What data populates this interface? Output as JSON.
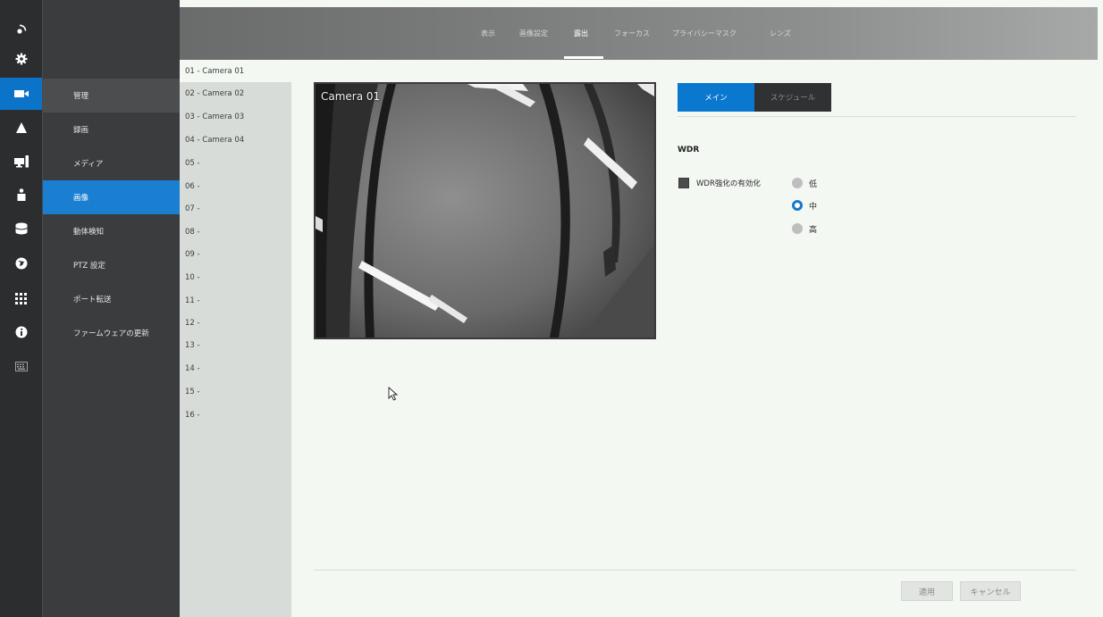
{
  "rail": {
    "icons": [
      {
        "name": "logo-icon"
      },
      {
        "name": "settings-icon"
      },
      {
        "name": "camera-icon",
        "active": true
      },
      {
        "name": "alert-icon"
      },
      {
        "name": "monitor-icon"
      },
      {
        "name": "user-icon"
      },
      {
        "name": "storage-icon"
      },
      {
        "name": "network-icon"
      },
      {
        "name": "apps-icon"
      },
      {
        "name": "info-icon"
      },
      {
        "name": "keyboard-icon"
      }
    ]
  },
  "menu": {
    "items": [
      {
        "label": "管理"
      },
      {
        "label": "録画"
      },
      {
        "label": "メディア"
      },
      {
        "label": "画像",
        "active": true
      },
      {
        "label": "動体検知"
      },
      {
        "label": "PTZ 設定"
      },
      {
        "label": "ポート転送"
      },
      {
        "label": "ファームウェアの更新"
      }
    ]
  },
  "channels": [
    "01 - Camera 01",
    "02 - Camera 02",
    "03 - Camera 03",
    "04 - Camera 04",
    "05 -",
    "06 -",
    "07 -",
    "08 -",
    "09 -",
    "10 -",
    "11 -",
    "12 -",
    "13 -",
    "14 -",
    "15 -",
    "16 -"
  ],
  "topbar": {
    "tabs": [
      "表示",
      "画像設定",
      "露出",
      "フォーカス",
      "プライバシーマスク",
      "レンズ"
    ],
    "active_tab": "露出"
  },
  "preview": {
    "camera_label": "Camera 01"
  },
  "settings": {
    "subtabs": {
      "main": "メイン",
      "schedule": "スケジュール"
    },
    "wdr_title": "WDR",
    "wdr_enhance_label": "WDR強化の有効化",
    "levels": [
      {
        "label": "低",
        "selected": false
      },
      {
        "label": "中",
        "selected": true
      },
      {
        "label": "高",
        "selected": false
      }
    ]
  },
  "footer": {
    "apply": "適用",
    "cancel": "キャンセル"
  },
  "colors": {
    "accent": "#0b74c9",
    "rail_bg": "#2b2d2e",
    "menu_bg": "#3a3c3d",
    "content_bg": "#f4f8f3"
  }
}
